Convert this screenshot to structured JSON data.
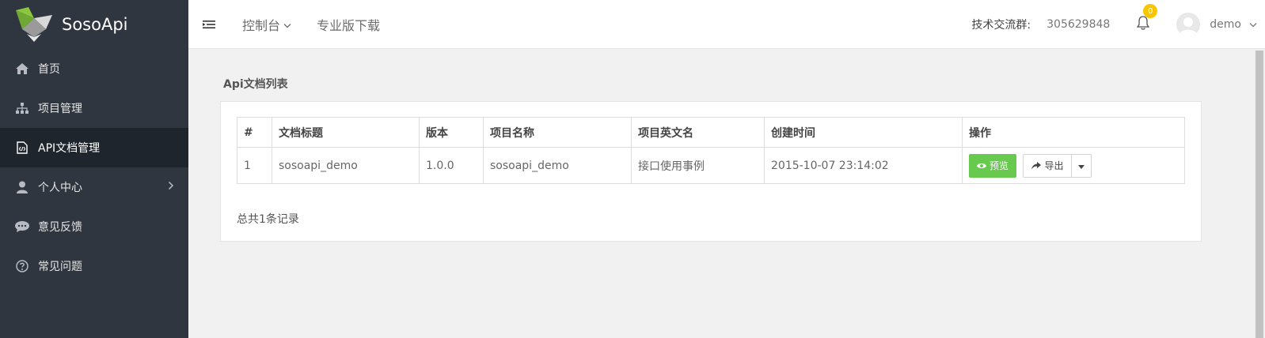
{
  "brand": {
    "name": "SosoApi"
  },
  "sidebar": {
    "items": [
      {
        "label": "首页",
        "icon": "home-icon"
      },
      {
        "label": "项目管理",
        "icon": "sitemap-icon"
      },
      {
        "label": "API文档管理",
        "icon": "file-code-icon",
        "active": true
      },
      {
        "label": "个人中心",
        "icon": "user-icon"
      },
      {
        "label": "意见反馈",
        "icon": "comment-icon"
      },
      {
        "label": "常见问题",
        "icon": "question-circle-icon"
      }
    ]
  },
  "header": {
    "nav": [
      {
        "label": "控制台"
      },
      {
        "label": "专业版下载"
      }
    ],
    "qq_label": "技术交流群:",
    "qq_number": "305629848",
    "notifications": "0",
    "user": "demo"
  },
  "main": {
    "title": "Api文档列表",
    "columns": [
      "#",
      "文档标题",
      "版本",
      "项目名称",
      "项目英文名",
      "创建时间",
      "操作"
    ],
    "rows": [
      {
        "index": "1",
        "doc_title": "sosoapi_demo",
        "version": "1.0.0",
        "project_name": "sosoapi_demo",
        "project_en_name": "接口使用事例",
        "created": "2015-10-07 23:14:02"
      }
    ],
    "actions": {
      "preview": "预览",
      "export": "导出"
    },
    "total": "总共1条记录"
  },
  "colors": {
    "sidebar_bg": "#2f3640",
    "sidebar_active_bg": "#1f252c",
    "preview_button": "#67c94e",
    "badge": "#f7c600"
  }
}
